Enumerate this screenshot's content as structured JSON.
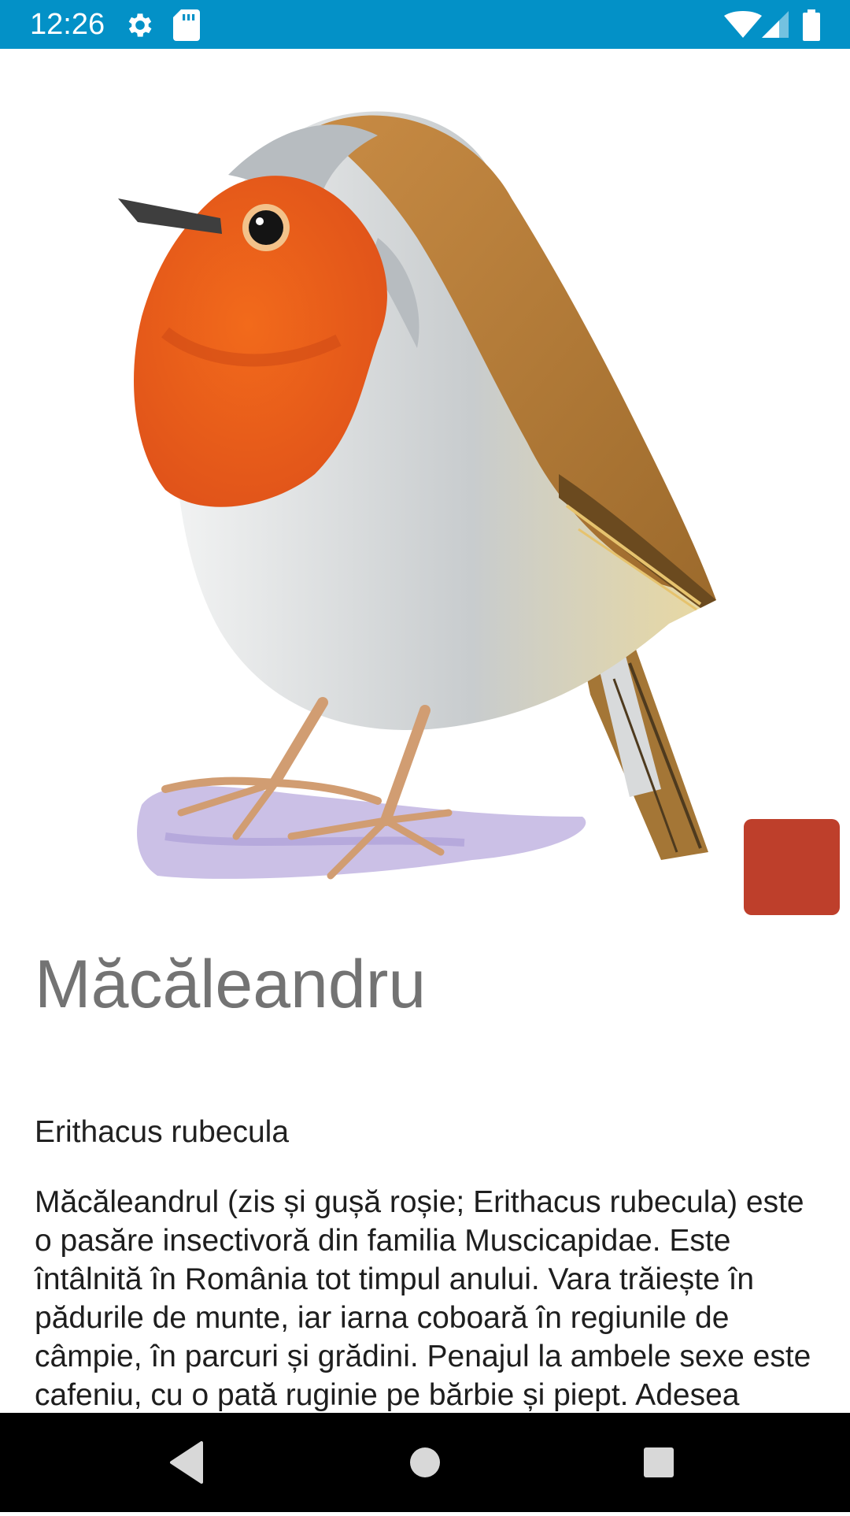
{
  "status_bar": {
    "time": "12:26",
    "background_color": "#0391c7",
    "left_icons": [
      "gear-icon",
      "sd-card-icon"
    ],
    "right_icons": [
      "wifi-icon",
      "cell-signal-icon",
      "battery-icon"
    ]
  },
  "species": {
    "common_name": "Măcăleandru",
    "scientific_name": "Erithacus rubecula",
    "description": "Măcăleandrul (zis și gușă roșie; Erithacus rubecula) este o pasăre insectivoră din familia Muscicapidae. Este întâlnită în România tot timpul anului. Vara trăiește în pădurile de munte, iar iarna coboară în regiunile de câmpie, în parcuri și grădini. Penajul la ambele sexe este cafeniu, cu o pată ruginie pe bărbie și piept. Adesea populațiile"
  },
  "action_button": {
    "color": "#be3f2b"
  },
  "nav_bar": {
    "buttons": [
      "back-icon",
      "home-icon",
      "recents-icon"
    ]
  }
}
